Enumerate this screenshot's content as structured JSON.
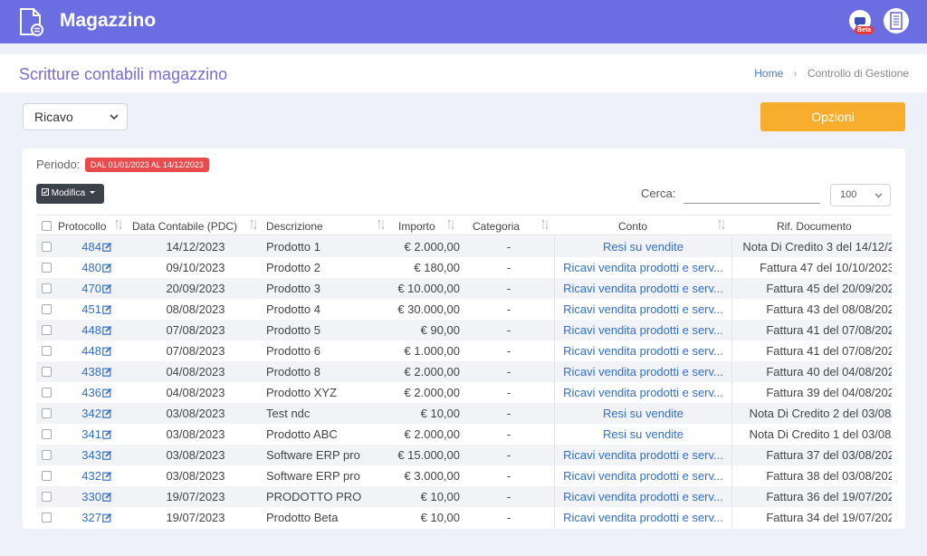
{
  "app": {
    "title": "Magazzino",
    "beta_label": "Beta"
  },
  "header": {
    "page_title": "Scritture contabili magazzino",
    "breadcrumb": [
      "Home",
      "Controllo di Gestione"
    ]
  },
  "filters": {
    "tipo_selected": "Ricavo",
    "opzioni_label": "Opzioni"
  },
  "card": {
    "periodo_label": "Periodo:",
    "periodo_badge": "DAL 01/01/2023 AL 14/12/2023",
    "modifica_label": "Modifica",
    "cerca_label": "Cerca:",
    "cerca_value": "",
    "page_size": "100"
  },
  "table": {
    "columns": [
      "Protocollo",
      "Data Contabile (PDC)",
      "Descrizione",
      "Importo",
      "Categoria",
      "Conto",
      "Rif. Documento"
    ],
    "rows": [
      [
        "484",
        "14/12/2023",
        "Prodotto 1",
        "€ 2.000,00",
        "-",
        "Resi su vendite",
        "Nota Di Credito 3 del 14/12/2"
      ],
      [
        "480",
        "09/10/2023",
        "Prodotto 2",
        "€ 180,00",
        "-",
        "Ricavi vendita prodotti e serv...",
        "Fattura 47 del 10/10/2023"
      ],
      [
        "470",
        "20/09/2023",
        "Prodotto 3",
        "€ 10.000,00",
        "-",
        "Ricavi vendita prodotti e serv...",
        "Fattura 45 del 20/09/202"
      ],
      [
        "451",
        "08/08/2023",
        "Prodotto 4",
        "€ 30.000,00",
        "-",
        "Ricavi vendita prodotti e serv...",
        "Fattura 43 del 08/08/202"
      ],
      [
        "448",
        "07/08/2023",
        "Prodotto 5",
        "€ 90,00",
        "-",
        "Ricavi vendita prodotti e serv...",
        "Fattura 41 del 07/08/202"
      ],
      [
        "448",
        "07/08/2023",
        "Prodotto 6",
        "€ 1.000,00",
        "-",
        "Ricavi vendita prodotti e serv...",
        "Fattura 41 del 07/08/202"
      ],
      [
        "438",
        "04/08/2023",
        "Prodotto 8",
        "€ 2.000,00",
        "-",
        "Ricavi vendita prodotti e serv...",
        "Fattura 40 del 04/08/202"
      ],
      [
        "436",
        "04/08/2023",
        "Prodotto XYZ",
        "€ 2.000,00",
        "-",
        "Ricavi vendita prodotti e serv...",
        "Fattura 39 del 04/08/202"
      ],
      [
        "342",
        "03/08/2023",
        "Test ndc",
        "€ 10,00",
        "-",
        "Resi su vendite",
        "Nota Di Credito 2 del 03/08/"
      ],
      [
        "341",
        "03/08/2023",
        "Prodotto ABC",
        "€ 2.000,00",
        "-",
        "Resi su vendite",
        "Nota Di Credito 1 del 03/08/"
      ],
      [
        "343",
        "03/08/2023",
        "Software ERP pro",
        "€ 15.000,00",
        "-",
        "Ricavi vendita prodotti e serv...",
        "Fattura 37 del 03/08/202"
      ],
      [
        "432",
        "03/08/2023",
        "Software ERP pro",
        "€ 3.000,00",
        "-",
        "Ricavi vendita prodotti e serv...",
        "Fattura 38 del 03/08/202"
      ],
      [
        "330",
        "19/07/2023",
        "PRODOTTO PRO",
        "€ 10,00",
        "-",
        "Ricavi vendita prodotti e serv...",
        "Fattura 36 del 19/07/202"
      ],
      [
        "327",
        "19/07/2023",
        "Prodotto Beta",
        "€ 10,00",
        "-",
        "Ricavi vendita prodotti e serv...",
        "Fattura 34 del 19/07/202"
      ]
    ]
  },
  "colors": {
    "topbar": "#6b6ee0",
    "accent": "#f9ad2c",
    "link": "#2f6fcf",
    "badge": "#e84b4b"
  },
  "icons": [
    "document-list-icon",
    "beta-feedback-icon",
    "company-building-icon",
    "edit-icon",
    "sort-icon",
    "chevron-down-icon",
    "checkbox-icon"
  ]
}
